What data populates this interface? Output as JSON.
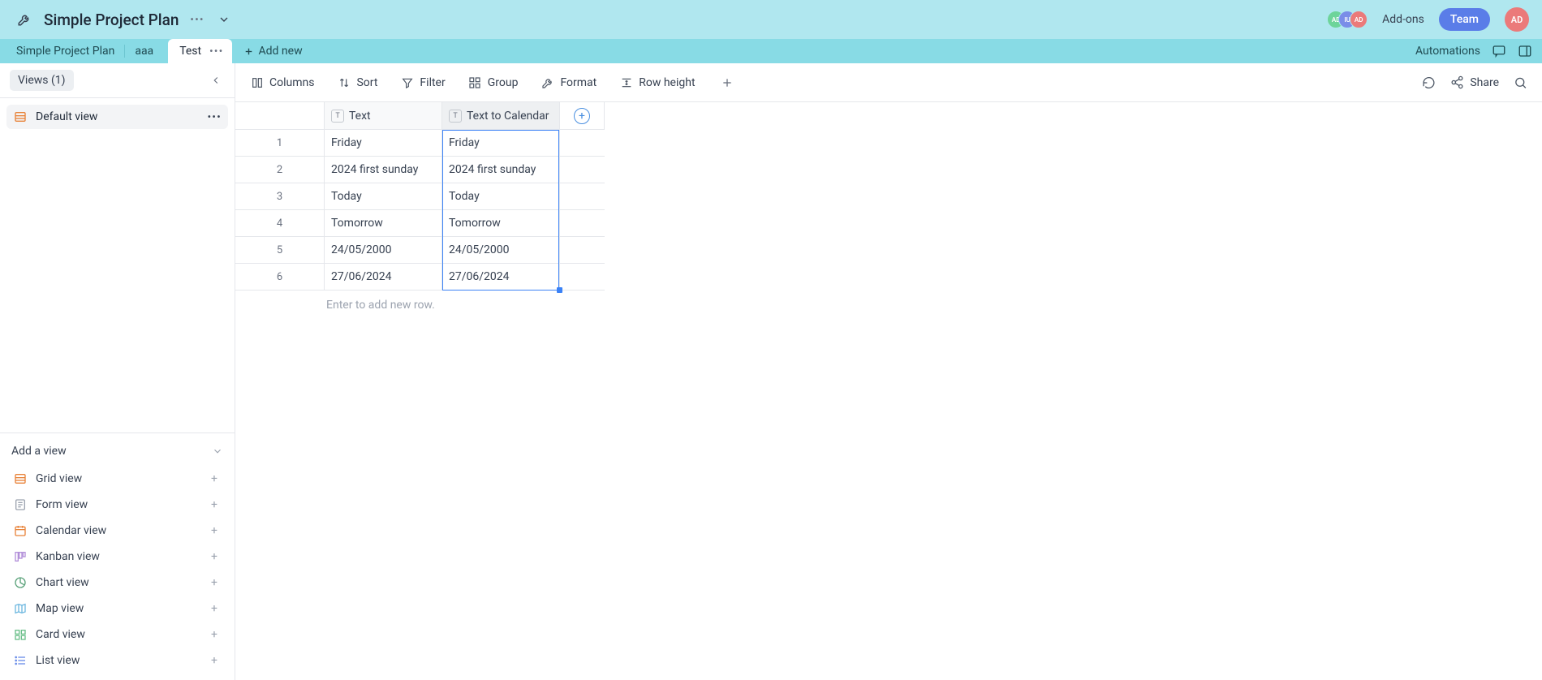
{
  "header": {
    "title": "Simple Project Plan"
  },
  "topbar": {
    "addons_label": "Add-ons",
    "team_label": "Team",
    "avatar_initials": "AD",
    "small_avatars": [
      {
        "initials": "AD",
        "color": "#6dd49a"
      },
      {
        "initials": "IU",
        "color": "#7a8de8"
      },
      {
        "initials": "AD",
        "color": "#eb7a7a"
      }
    ]
  },
  "tabs": {
    "breadcrumb": "Simple Project Plan",
    "items": [
      "aaa",
      "Test"
    ],
    "active": "Test",
    "add_new_label": "Add new",
    "automations_label": "Automations"
  },
  "sidebar": {
    "views_label": "Views (1)",
    "current_view": "Default view",
    "add_view_label": "Add a view",
    "view_types": [
      {
        "name": "Grid view",
        "icon": "grid",
        "color": "#e8833a"
      },
      {
        "name": "Form view",
        "icon": "form",
        "color": "#9ca3af"
      },
      {
        "name": "Calendar view",
        "icon": "calendar",
        "color": "#e8833a"
      },
      {
        "name": "Kanban view",
        "icon": "kanban",
        "color": "#b28fd9"
      },
      {
        "name": "Chart view",
        "icon": "chart",
        "color": "#5aa27a"
      },
      {
        "name": "Map view",
        "icon": "map",
        "color": "#6fb8e0"
      },
      {
        "name": "Card view",
        "icon": "card",
        "color": "#6bbf8a"
      },
      {
        "name": "List view",
        "icon": "list",
        "color": "#6a8de8"
      }
    ]
  },
  "toolbar": {
    "columns": "Columns",
    "sort": "Sort",
    "filter": "Filter",
    "group": "Group",
    "format": "Format",
    "row_height": "Row height",
    "share": "Share"
  },
  "grid": {
    "columns": [
      {
        "key": "text",
        "label": "Text",
        "type": "T"
      },
      {
        "key": "ttc",
        "label": "Text to Calendar",
        "type": "T"
      }
    ],
    "rows": [
      {
        "n": 1,
        "text": "Friday",
        "ttc": "Friday"
      },
      {
        "n": 2,
        "text": "2024 first sunday",
        "ttc": "2024 first sunday"
      },
      {
        "n": 3,
        "text": "Today",
        "ttc": "Today"
      },
      {
        "n": 4,
        "text": "Tomorrow",
        "ttc": "Tomorrow"
      },
      {
        "n": 5,
        "text": "24/05/2000",
        "ttc": "24/05/2000"
      },
      {
        "n": 6,
        "text": "27/06/2024",
        "ttc": "27/06/2024"
      }
    ],
    "add_row_hint": "Enter to add new row."
  }
}
